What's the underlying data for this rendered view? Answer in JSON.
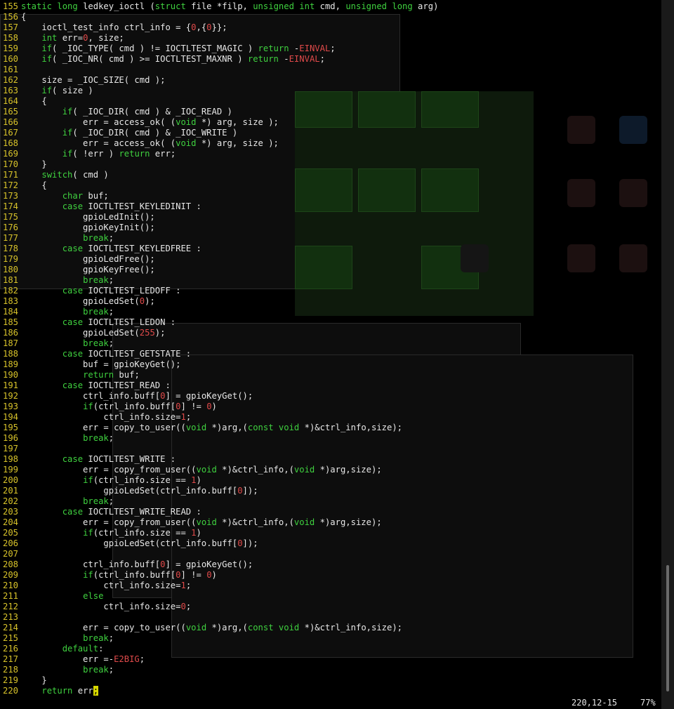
{
  "editor": {
    "lines": [
      {
        "n": "155",
        "t": "static long ledkey_ioctl (struct file *filp, unsigned int cmd, unsigned long arg)"
      },
      {
        "n": "156",
        "t": "{"
      },
      {
        "n": "157",
        "t": "    ioctl_test_info ctrl_info = {0,{0}};"
      },
      {
        "n": "158",
        "t": "    int err=0, size;"
      },
      {
        "n": "159",
        "t": "    if( _IOC_TYPE( cmd ) != IOCTLTEST_MAGIC ) return -EINVAL;"
      },
      {
        "n": "160",
        "t": "    if( _IOC_NR( cmd ) >= IOCTLTEST_MAXNR ) return -EINVAL;"
      },
      {
        "n": "161",
        "t": ""
      },
      {
        "n": "162",
        "t": "    size = _IOC_SIZE( cmd );"
      },
      {
        "n": "163",
        "t": "    if( size )"
      },
      {
        "n": "164",
        "t": "    {"
      },
      {
        "n": "165",
        "t": "        if( _IOC_DIR( cmd ) & _IOC_READ )"
      },
      {
        "n": "166",
        "t": "            err = access_ok( (void *) arg, size );"
      },
      {
        "n": "167",
        "t": "        if( _IOC_DIR( cmd ) & _IOC_WRITE )"
      },
      {
        "n": "168",
        "t": "            err = access_ok( (void *) arg, size );"
      },
      {
        "n": "169",
        "t": "        if( !err ) return err;"
      },
      {
        "n": "170",
        "t": "    }"
      },
      {
        "n": "171",
        "t": "    switch( cmd )"
      },
      {
        "n": "172",
        "t": "    {"
      },
      {
        "n": "173",
        "t": "        char buf;"
      },
      {
        "n": "174",
        "t": "        case IOCTLTEST_KEYLEDINIT :"
      },
      {
        "n": "175",
        "t": "            gpioLedInit();"
      },
      {
        "n": "176",
        "t": "            gpioKeyInit();"
      },
      {
        "n": "177",
        "t": "            break;"
      },
      {
        "n": "178",
        "t": "        case IOCTLTEST_KEYLEDFREE :"
      },
      {
        "n": "179",
        "t": "            gpioLedFree();"
      },
      {
        "n": "180",
        "t": "            gpioKeyFree();"
      },
      {
        "n": "181",
        "t": "            break;"
      },
      {
        "n": "182",
        "t": "        case IOCTLTEST_LEDOFF :"
      },
      {
        "n": "183",
        "t": "            gpioLedSet(0);"
      },
      {
        "n": "184",
        "t": "            break;"
      },
      {
        "n": "185",
        "t": "        case IOCTLTEST_LEDON :"
      },
      {
        "n": "186",
        "t": "            gpioLedSet(255);"
      },
      {
        "n": "187",
        "t": "            break;"
      },
      {
        "n": "188",
        "t": "        case IOCTLTEST_GETSTATE :"
      },
      {
        "n": "189",
        "t": "            buf = gpioKeyGet();"
      },
      {
        "n": "190",
        "t": "            return buf;"
      },
      {
        "n": "191",
        "t": "        case IOCTLTEST_READ :"
      },
      {
        "n": "192",
        "t": "            ctrl_info.buff[0] = gpioKeyGet();"
      },
      {
        "n": "193",
        "t": "            if(ctrl_info.buff[0] != 0)"
      },
      {
        "n": "194",
        "t": "                ctrl_info.size=1;"
      },
      {
        "n": "195",
        "t": "            err = copy_to_user((void *)arg,(const void *)&ctrl_info,size);"
      },
      {
        "n": "196",
        "t": "            break;"
      },
      {
        "n": "197",
        "t": ""
      },
      {
        "n": "198",
        "t": "        case IOCTLTEST_WRITE :"
      },
      {
        "n": "199",
        "t": "            err = copy_from_user((void *)&ctrl_info,(void *)arg,size);"
      },
      {
        "n": "200",
        "t": "            if(ctrl_info.size == 1)"
      },
      {
        "n": "201",
        "t": "                gpioLedSet(ctrl_info.buff[0]);"
      },
      {
        "n": "202",
        "t": "            break;"
      },
      {
        "n": "203",
        "t": "        case IOCTLTEST_WRITE_READ :"
      },
      {
        "n": "204",
        "t": "            err = copy_from_user((void *)&ctrl_info,(void *)arg,size);"
      },
      {
        "n": "205",
        "t": "            if(ctrl_info.size == 1)"
      },
      {
        "n": "206",
        "t": "                gpioLedSet(ctrl_info.buff[0]);"
      },
      {
        "n": "207",
        "t": ""
      },
      {
        "n": "208",
        "t": "            ctrl_info.buff[0] = gpioKeyGet();"
      },
      {
        "n": "209",
        "t": "            if(ctrl_info.buff[0] != 0)"
      },
      {
        "n": "210",
        "t": "                ctrl_info.size=1;"
      },
      {
        "n": "211",
        "t": "            else"
      },
      {
        "n": "212",
        "t": "                ctrl_info.size=0;"
      },
      {
        "n": "213",
        "t": ""
      },
      {
        "n": "214",
        "t": "            err = copy_to_user((void *)arg,(const void *)&ctrl_info,size);"
      },
      {
        "n": "215",
        "t": "            break;"
      },
      {
        "n": "216",
        "t": "        default:"
      },
      {
        "n": "217",
        "t": "            err =-E2BIG;"
      },
      {
        "n": "218",
        "t": "            break;"
      },
      {
        "n": "219",
        "t": "    }"
      },
      {
        "n": "220",
        "t": "    return err;"
      }
    ],
    "cursor_line": "220"
  },
  "status": {
    "position": "220,12-15",
    "percent": "77%"
  },
  "colors": {
    "background": "#000000",
    "text": "#e8e8e8",
    "line_number": "#d7c22a",
    "keyword": "#3fd13f",
    "number": "#e04a4a",
    "cursor": "#d7d700"
  }
}
